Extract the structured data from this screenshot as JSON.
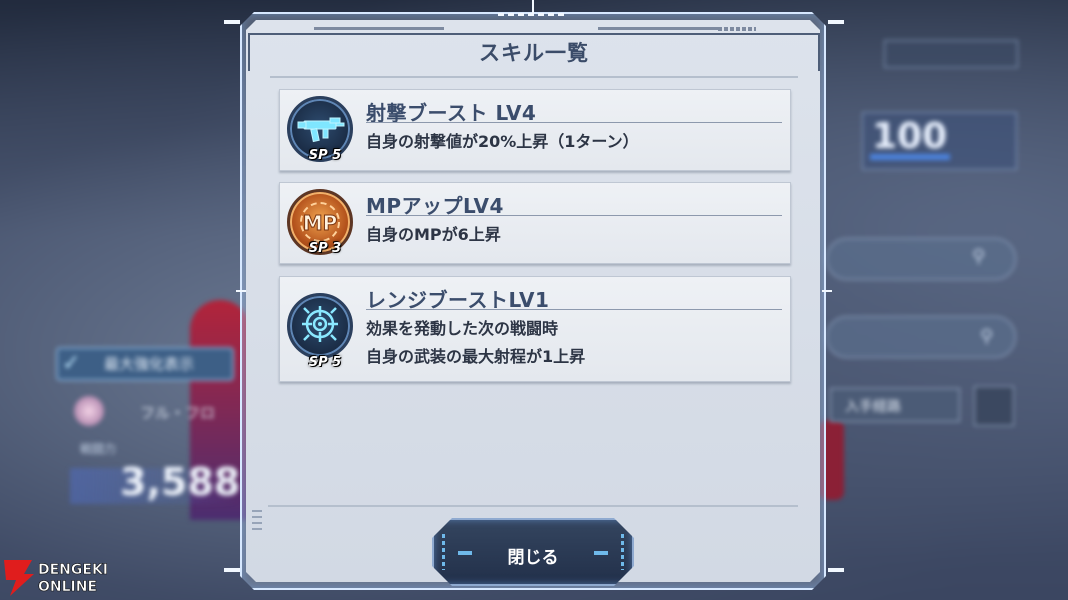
{
  "background": {
    "max_enhance_label": "最大強化表示",
    "pilot_name": "フル・フロ",
    "stat_label": "戦闘力",
    "stat_value": "3,588",
    "right_value": "100",
    "acquire_button": "入手経路"
  },
  "modal": {
    "title": "スキル一覧",
    "close_label": "閉じる"
  },
  "skills": [
    {
      "name": "射撃ブースト LV4",
      "desc_lines": [
        "自身の射撃値が20%上昇（1ターン）"
      ],
      "sp": "SP 5",
      "icon": "rifle-icon",
      "icon_color": "#1f3350"
    },
    {
      "name": "MPアップLV4",
      "desc_lines": [
        "自身のMPが6上昇"
      ],
      "sp": "SP 3",
      "icon": "mp-icon",
      "icon_color": "#d0702c"
    },
    {
      "name": "レンジブーストLV1",
      "desc_lines": [
        "効果を発動した次の戦闘時",
        "自身の武装の最大射程が1上昇"
      ],
      "sp": "SP 5",
      "icon": "crosshair-icon",
      "icon_color": "#1f3350"
    }
  ],
  "watermark": "DENGEKI ONLINE",
  "colors": {
    "title_text": "#3b4c69",
    "panel_bg": "#d8dee8",
    "glow": "#8cbeff"
  }
}
